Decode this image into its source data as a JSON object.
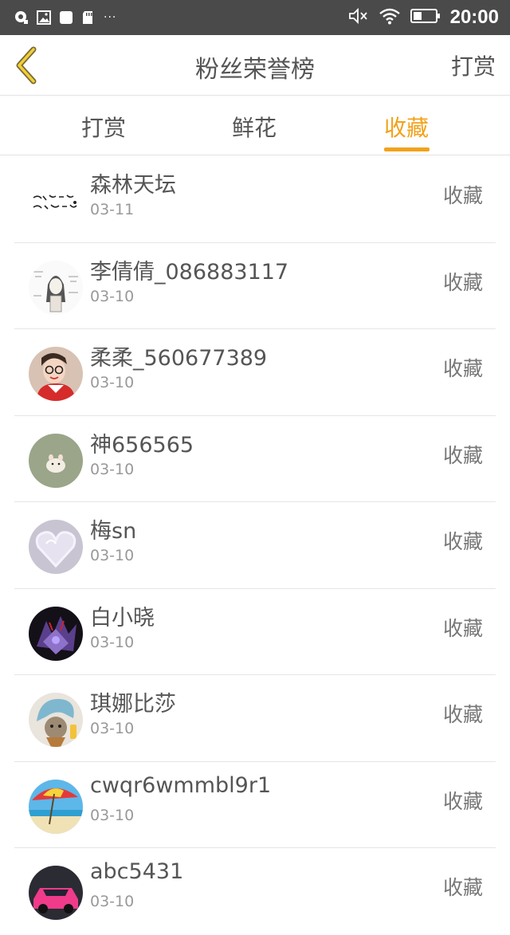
{
  "status_bar": {
    "time": "20:00",
    "more": "···",
    "left_icons": [
      "notification-icon",
      "image-icon",
      "square-icon",
      "sd-card-icon"
    ],
    "right_icons": [
      "mute-icon",
      "wifi-icon",
      "battery-icon"
    ]
  },
  "header": {
    "title": "粉丝荣誉榜",
    "action": "打赏",
    "back_icon": "chevron-left-icon"
  },
  "tabs": [
    {
      "label": "打赏",
      "active": false
    },
    {
      "label": "鲜花",
      "active": false
    },
    {
      "label": "收藏",
      "active": true
    }
  ],
  "colors": {
    "accent": "#f2a21b",
    "status_bar": "#4a4a4a",
    "text": "#555555",
    "subtext": "#999999"
  },
  "fans": [
    {
      "name": "森林天坛",
      "date": "03-11",
      "action": "收藏",
      "avatar": "calligraphy-avatar"
    },
    {
      "name": "李倩倩_086883117",
      "date": "03-10",
      "action": "收藏",
      "avatar": "sketch-girl-avatar"
    },
    {
      "name": "柔柔_560677389",
      "date": "03-10",
      "action": "收藏",
      "avatar": "woman-glasses-avatar"
    },
    {
      "name": "神656565",
      "date": "03-10",
      "action": "收藏",
      "avatar": "hamster-avatar"
    },
    {
      "name": "梅sn",
      "date": "03-10",
      "action": "收藏",
      "avatar": "heart-avatar"
    },
    {
      "name": "白小晓",
      "date": "03-10",
      "action": "收藏",
      "avatar": "anime-avatar"
    },
    {
      "name": "琪娜比莎",
      "date": "03-10",
      "action": "收藏",
      "avatar": "cat-towel-avatar"
    },
    {
      "name": "cwqr6wmmbl9r1",
      "date": "03-10",
      "action": "收藏",
      "avatar": "beach-umbrella-avatar"
    },
    {
      "name": "abc5431",
      "date": "03-10",
      "action": "收藏",
      "avatar": "pink-car-avatar"
    }
  ]
}
